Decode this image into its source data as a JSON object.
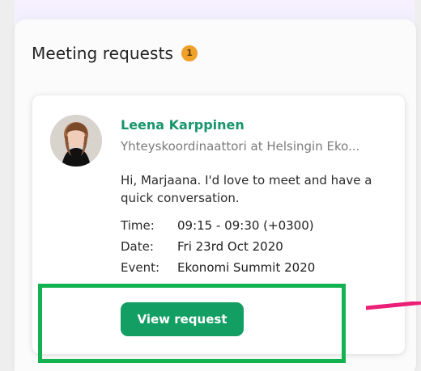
{
  "section": {
    "title": "Meeting requests",
    "count": "1"
  },
  "request": {
    "name": "Leena Karppinen",
    "title": "Yhteyskoordinaattori at Helsingin Eko...",
    "message": "Hi, Marjaana. I'd love to meet and have a quick conversation.",
    "details": {
      "time_label": "Time:",
      "time_value": "09:15 - 09:30 (+0300)",
      "date_label": "Date:",
      "date_value": "Fri 23rd Oct 2020",
      "event_label": "Event:",
      "event_value": "Ekonomi Summit 2020"
    },
    "button_label": "View request"
  },
  "colors": {
    "accent_green": "#139e63",
    "name_green": "#17966a",
    "badge_orange": "#f0a12a",
    "highlight_green": "#11b24f",
    "pointer_pink": "#ec1f77"
  },
  "icons": {
    "avatar": "avatar",
    "badge": "notification-count-badge",
    "annotation": "pink-pointer-line"
  }
}
